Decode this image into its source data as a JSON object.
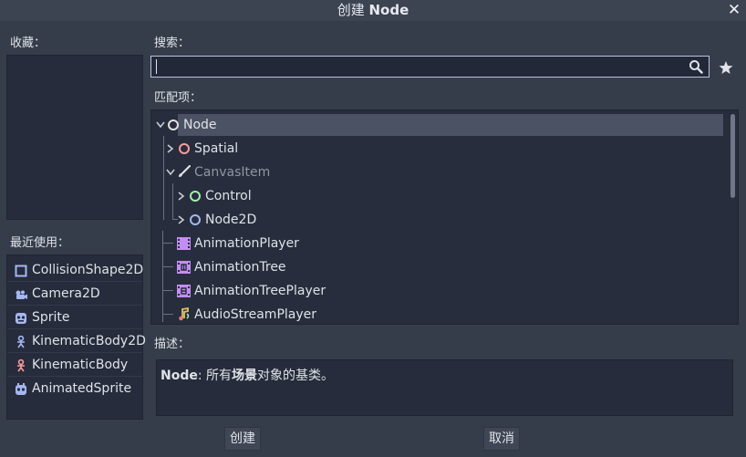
{
  "window": {
    "title_prefix": "创建",
    "title_node": "Node",
    "close_glyph": "✕"
  },
  "favorites": {
    "label": "收藏："
  },
  "recent": {
    "label": "最近使用：",
    "items": [
      {
        "label": "CollisionShape2D",
        "icon": "collision-shape-icon",
        "color": "#a5b7f3"
      },
      {
        "label": "Camera2D",
        "icon": "camera-icon",
        "color": "#a5b7f3"
      },
      {
        "label": "Sprite",
        "icon": "sprite-icon",
        "color": "#a5b7f3"
      },
      {
        "label": "KinematicBody2D",
        "icon": "kinematic-body-icon",
        "color": "#a5b7f3"
      },
      {
        "label": "KinematicBody",
        "icon": "kinematic-body-3d-icon",
        "color": "#fc9c9c"
      },
      {
        "label": "AnimatedSprite",
        "icon": "animated-sprite-icon",
        "color": "#a5b7f3"
      }
    ]
  },
  "search": {
    "label": "搜索：",
    "value": "",
    "placeholder": ""
  },
  "matches": {
    "label": "匹配项：",
    "items": [
      {
        "label": "Node",
        "icon": "node-icon",
        "color": "#e0e0e0",
        "selected": true,
        "expanded": true
      },
      {
        "label": "Spatial",
        "icon": "spatial-icon",
        "color": "#fc9c9c",
        "expanded": false
      },
      {
        "label": "CanvasItem",
        "icon": "canvas-item-icon",
        "color": "#e0e0e0",
        "disabled": true,
        "expanded": true
      },
      {
        "label": "Control",
        "icon": "control-icon",
        "color": "#a5efac",
        "expanded": false
      },
      {
        "label": "Node2D",
        "icon": "node2d-icon",
        "color": "#a5b7f3",
        "expanded": false
      },
      {
        "label": "AnimationPlayer",
        "icon": "animation-player-icon",
        "color": "#c38ef1"
      },
      {
        "label": "AnimationTree",
        "icon": "animation-tree-icon",
        "color": "#c38ef1"
      },
      {
        "label": "AnimationTreePlayer",
        "icon": "animation-tree-player-icon",
        "color": "#c38ef1"
      },
      {
        "label": "AudioStreamPlayer",
        "icon": "audio-stream-player-icon",
        "color": "#e0a060"
      }
    ]
  },
  "description": {
    "label": "描述：",
    "node_name": "Node",
    "text_before": ": 所有",
    "bold_word": "场景",
    "text_after": "对象的基类。"
  },
  "buttons": {
    "create": "创建",
    "cancel": "取消"
  }
}
